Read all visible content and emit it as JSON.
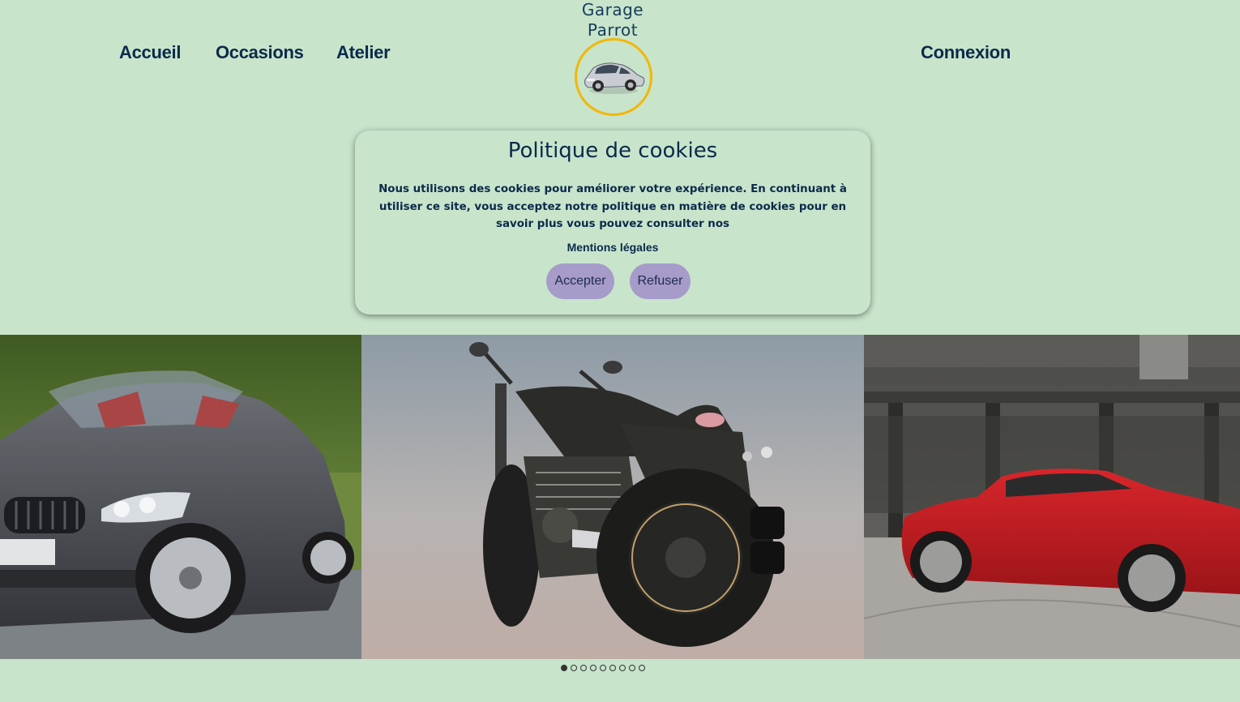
{
  "nav": {
    "home": "Accueil",
    "used_cars": "Occasions",
    "workshop": "Atelier",
    "login": "Connexion"
  },
  "brand": {
    "line1": "Garage",
    "line2": "Parrot",
    "logo_border_color": "#f2b705"
  },
  "cookie_banner": {
    "title": "Politique de cookies",
    "text": "Nous utilisons des cookies pour améliorer votre expérience. En continuant à utiliser ce site, vous acceptez notre politique en matière de cookies pour en savoir plus vous pouvez consulter nos",
    "link": "Mentions légales",
    "accept_label": "Accepter",
    "refuse_label": "Refuser",
    "button_color": "#a69bc9"
  },
  "carousel": {
    "slides": [
      "grey-bmw-roadster-photo",
      "black-motorcycle-render",
      "red-vintage-coupe-photo"
    ],
    "dot_count": 9,
    "active_index": 0
  },
  "colors": {
    "background": "#c8e4cb",
    "text_dark": "#0b2a4a"
  }
}
